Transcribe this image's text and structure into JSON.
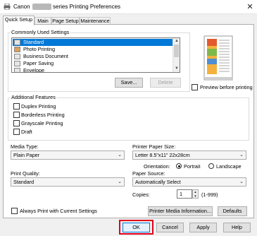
{
  "window": {
    "title_prefix": "Canon",
    "title_suffix": "series Printing Preferences",
    "close_glyph": "✕",
    "app_icon": "printer-icon"
  },
  "tabs": [
    {
      "label": "Quick Setup",
      "active": true
    },
    {
      "label": "Main",
      "active": false
    },
    {
      "label": "Page Setup",
      "active": false
    },
    {
      "label": "Maintenance",
      "active": false
    }
  ],
  "commonly_used": {
    "title": "Commonly Used Settings",
    "items": [
      {
        "label": "Standard",
        "selected": true
      },
      {
        "label": "Photo Printing",
        "selected": false
      },
      {
        "label": "Business Document",
        "selected": false
      },
      {
        "label": "Paper Saving",
        "selected": false
      },
      {
        "label": "Envelope",
        "selected": false
      }
    ],
    "save_button": "Save...",
    "delete_button": "Delete"
  },
  "preview": {
    "checkbox_label": "Preview before printing",
    "checked": false
  },
  "additional_features": {
    "title": "Additional Features",
    "items": [
      {
        "label": "Duplex Printing",
        "checked": false
      },
      {
        "label": "Borderless Printing",
        "checked": false
      },
      {
        "label": "Grayscale Printing",
        "checked": false
      },
      {
        "label": "Draft",
        "checked": false
      }
    ]
  },
  "media_type": {
    "label": "Media Type:",
    "value": "Plain Paper"
  },
  "printer_paper_size": {
    "label": "Printer Paper Size:",
    "value": "Letter 8.5\"x11\" 22x28cm"
  },
  "orientation": {
    "label": "Orientation:",
    "options": [
      {
        "label": "Portrait",
        "selected": true
      },
      {
        "label": "Landscape",
        "selected": false
      }
    ]
  },
  "print_quality": {
    "label": "Print Quality:",
    "value": "Standard"
  },
  "paper_source": {
    "label": "Paper Source:",
    "value": "Automatically Select"
  },
  "copies": {
    "label": "Copies:",
    "value": "1",
    "range": "(1-999)"
  },
  "always_print": {
    "label": "Always Print with Current Settings",
    "checked": false
  },
  "buttons": {
    "printer_media_info": "Printer Media Information...",
    "defaults": "Defaults",
    "ok": "OK",
    "cancel": "Cancel",
    "apply": "Apply",
    "help": "Help"
  },
  "colors": {
    "selection": "#0078d7",
    "highlight_frame": "#e0001a"
  }
}
